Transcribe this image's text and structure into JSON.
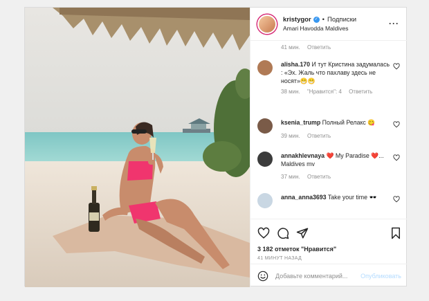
{
  "post": {
    "username": "kristygor",
    "follow_label": "Подписки",
    "location": "Amari Havodda Maldives",
    "more_icon": "more-options-icon"
  },
  "comments_top_meta": {
    "time": "41 мин.",
    "reply": "Ответить"
  },
  "comments": [
    {
      "user": "alisha.170",
      "text": "И тут Кристина задумалась : «Эх. Жаль что пахлаву здесь не носят»😁😁",
      "time": "38 мин.",
      "likes": "\"Нравится\": 4",
      "reply": "Ответить",
      "avatar_color": "#b07a55"
    },
    {
      "user": "ksenia_trump",
      "text": "Полный Релакс 😋",
      "time": "39 мин.",
      "reply": "Ответить",
      "avatar_color": "#7a5b48"
    },
    {
      "user": "annakhlevnaya",
      "text": "❤️ My Paradise ❤️... Maldives mv",
      "time": "37 мин.",
      "reply": "Ответить",
      "avatar_color": "#3c3c3c"
    },
    {
      "user": "anna_anna3693",
      "text": "Take your time 🕶️",
      "avatar_color": "#c9d7e3"
    }
  ],
  "actions": {
    "likes": "3 182 отметок \"Нравится\"",
    "time": "41 МИНУТ НАЗАД"
  },
  "add_comment": {
    "placeholder": "Добавьте комментарий...",
    "publish": "Опубликовать"
  },
  "colors": {
    "link_blue": "#3897f0",
    "publish_disabled": "#b3dbff",
    "muted": "#8e8e8e"
  }
}
